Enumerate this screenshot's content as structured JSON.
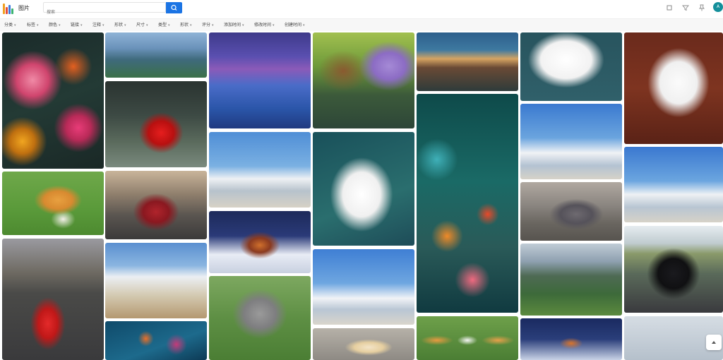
{
  "app": {
    "title": "图片",
    "avatar_initial": "A",
    "accent_color": "#1b74e4",
    "avatar_color": "#148f9b"
  },
  "search": {
    "placeholder": "搜索",
    "button_icon": "search-icon"
  },
  "toolbar": {
    "icons": [
      "crop-icon",
      "filter-icon",
      "pin-icon"
    ]
  },
  "filters": [
    {
      "label": "分类"
    },
    {
      "label": "标签"
    },
    {
      "label": "颜色"
    },
    {
      "label": "链接"
    },
    {
      "label": "注释"
    },
    {
      "label": "形状"
    },
    {
      "label": "尺寸"
    },
    {
      "label": "类型"
    },
    {
      "label": "形状"
    },
    {
      "label": "评分"
    },
    {
      "label": "添加时间"
    },
    {
      "label": "修改时间"
    },
    {
      "label": "创建时间"
    }
  ],
  "gallery": {
    "subjects": [
      [
        "colorful flower painting",
        "pomeranian dog on grass",
        "red sports car on road"
      ],
      [
        "mountain valley",
        "red sports car",
        "red sports car",
        "snowy mountain village",
        "underwater flowers"
      ],
      [
        "lake reflection",
        "snowy mountains",
        "cabin at night",
        "grey poodle"
      ],
      [
        "wooden bridge with wisteria",
        "white pomeranian",
        "snowy mountains",
        "puppy"
      ],
      [
        "volcano waterfall landscape",
        "fantasy flower art",
        "pomeranian puppies"
      ],
      [
        "white fluffy dog",
        "snowy mountains",
        "grey sports car",
        "green mountains",
        "cabin at night"
      ],
      [
        "pomeranian with toy",
        "snowy mountains",
        "black lamborghini",
        "landscape"
      ]
    ]
  },
  "scroll_top_icon": "arrow-up-icon"
}
